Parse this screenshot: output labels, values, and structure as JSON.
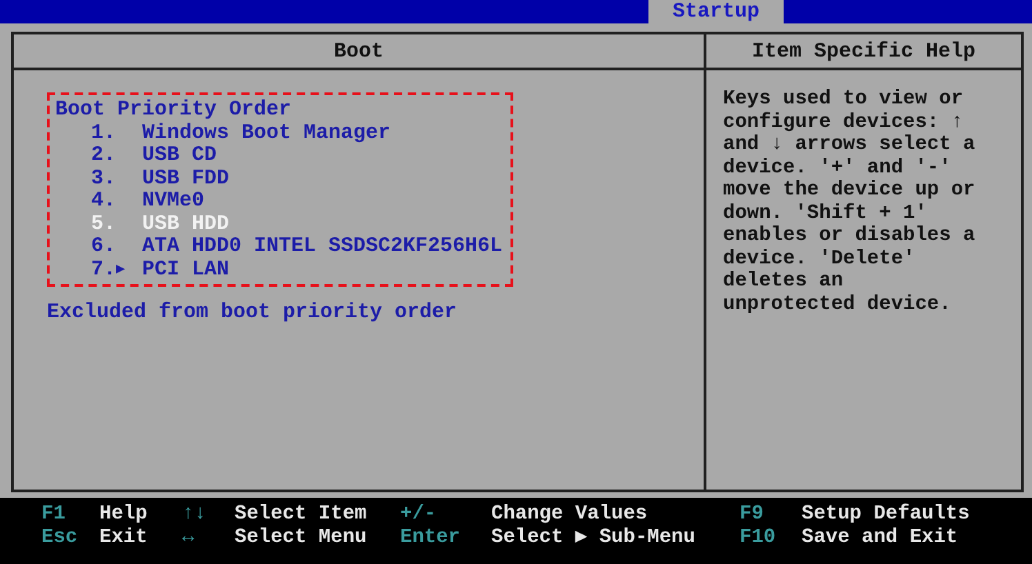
{
  "menu_bar": {
    "tabs": [
      {
        "label": "Startup",
        "selected": true
      }
    ]
  },
  "boot_panel": {
    "title": "Boot",
    "group_title": "Boot Priority Order",
    "items": [
      {
        "number": "1.",
        "marker": "",
        "label": "Windows Boot Manager",
        "selected": false
      },
      {
        "number": "2.",
        "marker": "",
        "label": "USB CD",
        "selected": false
      },
      {
        "number": "3.",
        "marker": "",
        "label": "USB FDD",
        "selected": false
      },
      {
        "number": "4.",
        "marker": "",
        "label": "NVMe0",
        "selected": false
      },
      {
        "number": "5.",
        "marker": "",
        "label": "USB HDD",
        "selected": true
      },
      {
        "number": "6.",
        "marker": "",
        "label": "ATA HDD0 INTEL SSDSC2KF256H6L",
        "selected": false
      },
      {
        "number": "7.",
        "marker": "▶",
        "label": "PCI LAN",
        "selected": false
      }
    ],
    "excluded_title": "Excluded from boot priority order"
  },
  "help_panel": {
    "title": "Item Specific Help",
    "text": "Keys used to view or configure devices: ↑ and ↓ arrows select a device. '+' and '-' move the device up or down. 'Shift + 1' enables or disables a device. 'Delete' deletes an unprotected device."
  },
  "footer": [
    {
      "key": "F1",
      "action": "Help"
    },
    {
      "key": "↑↓",
      "action": "Select Item"
    },
    {
      "key": "+/-",
      "action": "Change Values"
    },
    {
      "key": "F9",
      "action": "Setup Defaults"
    },
    {
      "key": "Esc",
      "action": "Exit"
    },
    {
      "key": "↔",
      "action": "Select Menu"
    },
    {
      "key": "Enter",
      "action": "Select ▶ Sub-Menu"
    },
    {
      "key": "F10",
      "action": "Save and Exit"
    }
  ]
}
